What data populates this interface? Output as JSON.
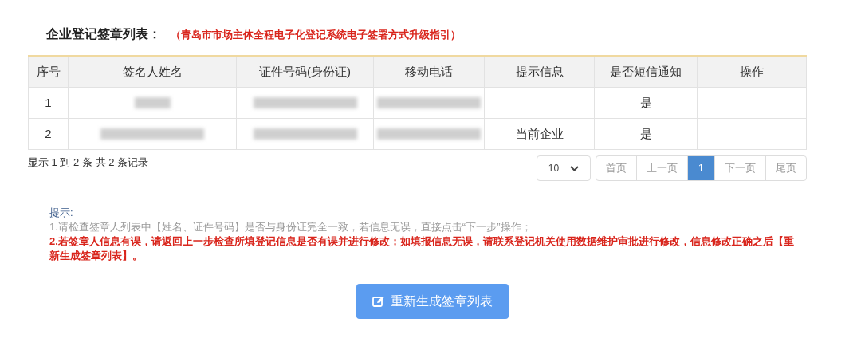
{
  "title": "企业登记签章列表：",
  "guide_link": "（青岛市市场主体全程电子化登记系统电子签署方式升级指引）",
  "table": {
    "columns": [
      "序号",
      "签名人姓名",
      "证件号码(身份证)",
      "移动电话",
      "提示信息",
      "是否短信通知",
      "操作"
    ],
    "rows": [
      {
        "cells": [
          {
            "kind": "text",
            "text": "1"
          },
          {
            "kind": "redacted-short"
          },
          {
            "kind": "redacted-long"
          },
          {
            "kind": "redacted-long"
          },
          {
            "kind": "empty"
          },
          {
            "kind": "text",
            "text": "是"
          },
          {
            "kind": "empty"
          }
        ]
      },
      {
        "cells": [
          {
            "kind": "text",
            "text": "2"
          },
          {
            "kind": "redacted-long"
          },
          {
            "kind": "redacted-long"
          },
          {
            "kind": "redacted-long"
          },
          {
            "kind": "text",
            "text": "当前企业"
          },
          {
            "kind": "text",
            "text": "是"
          },
          {
            "kind": "empty"
          }
        ]
      }
    ]
  },
  "summary": "显示 1 到 2 条 共 2 条记录",
  "page_size": "10",
  "pages": [
    {
      "label": "首页",
      "selected": false
    },
    {
      "label": "上一页",
      "selected": false
    },
    {
      "label": "1",
      "selected": true
    },
    {
      "label": "下一页",
      "selected": false
    },
    {
      "label": "尾页",
      "selected": false
    }
  ],
  "hint": {
    "title": "提示:",
    "lines": [
      {
        "kind": "normal",
        "text": "1.请检查签章人列表中【姓名、证件号码】是否与身份证完全一致，若信息无误，直接点击“下一步”操作；"
      },
      {
        "kind": "warning",
        "text": "2.若签章人信息有误，请返回上一步检查所填登记信息是否有误并进行修改；如填报信息无误，请联系登记机关使用数据维护审批进行修改，信息修改正确之后【重新生成签章列表】。"
      }
    ]
  },
  "button": "重新生成签章列表"
}
